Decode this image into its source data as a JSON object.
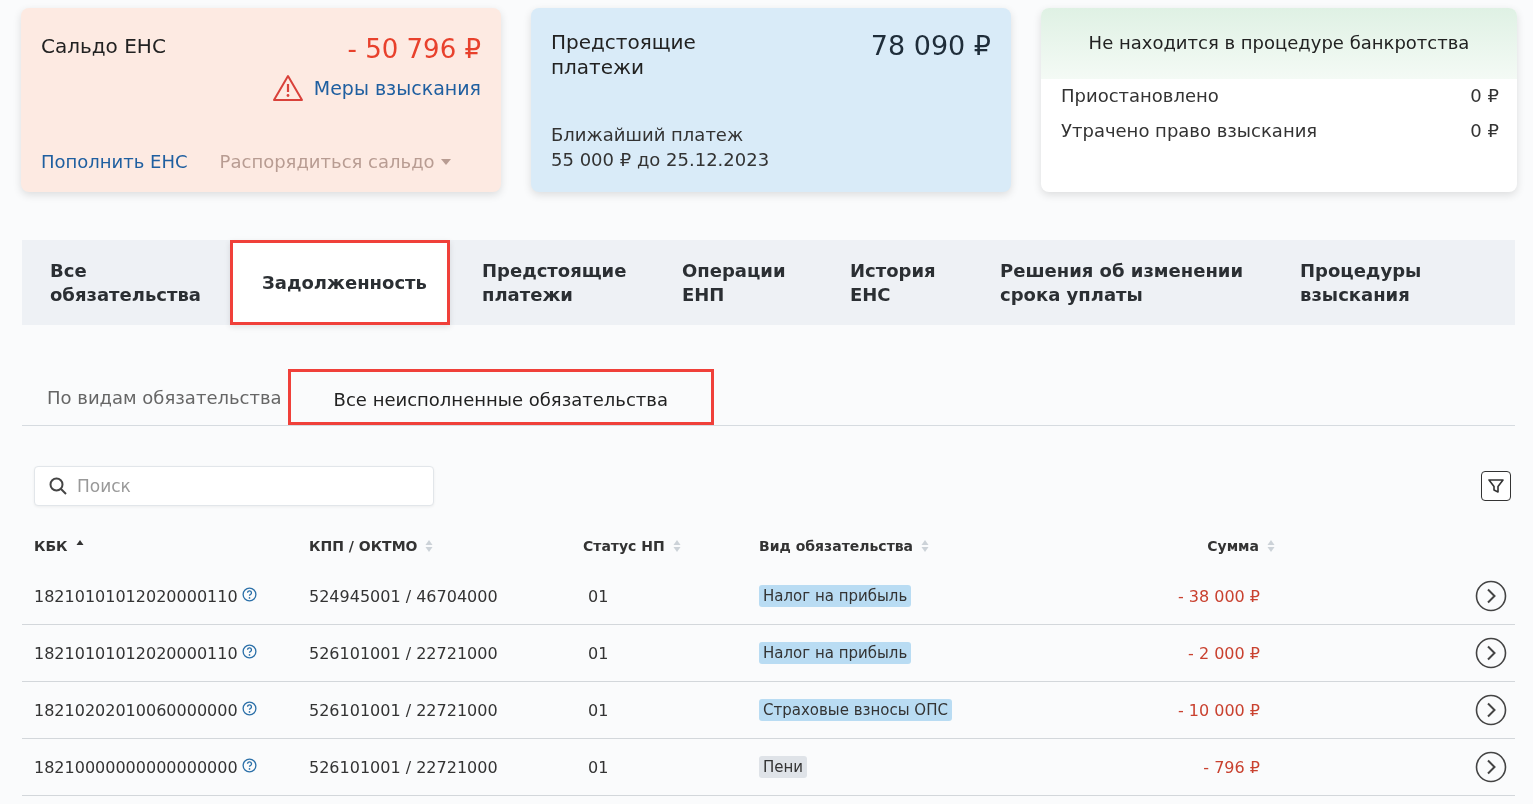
{
  "cards": {
    "balance": {
      "title": "Сальдо ЕНС",
      "amount": "- 50 796 ₽",
      "warning_link": "Меры взыскания",
      "actions": [
        {
          "label": "Пополнить ЕНС",
          "disabled": false,
          "dropdown": false
        },
        {
          "label": "Распорядиться сальдо",
          "disabled": true,
          "dropdown": true
        }
      ]
    },
    "upcoming": {
      "title": "Предстоящие платежи",
      "amount": "78 090 ₽",
      "next_label": "Ближайший платеж",
      "next_value": "55 000 ₽ до 25.12.2023"
    },
    "bankruptcy": {
      "title": "Не находится в процедуре банкротства",
      "rows": [
        {
          "label": "Приостановлено",
          "value": "0 ₽"
        },
        {
          "label": "Утрачено право взыскания",
          "value": "0 ₽"
        }
      ]
    }
  },
  "tabs": [
    {
      "label": "Все обязательства",
      "selected": false,
      "highlighted": false
    },
    {
      "label": "Задолженность",
      "selected": true,
      "highlighted": true
    },
    {
      "label": "Предстоящие платежи",
      "selected": false,
      "highlighted": false
    },
    {
      "label": "Операции ЕНП",
      "selected": false,
      "highlighted": false
    },
    {
      "label": "История ЕНС",
      "selected": false,
      "highlighted": false
    },
    {
      "label": "Решения об изменении срока уплаты",
      "selected": false,
      "highlighted": false
    },
    {
      "label": "Процедуры взыскания",
      "selected": false,
      "highlighted": false
    }
  ],
  "subtabs": [
    {
      "label": "По видам обязательства",
      "selected": false,
      "highlighted": false
    },
    {
      "label": "Все неисполненные обязательства",
      "selected": true,
      "highlighted": true
    }
  ],
  "search": {
    "placeholder": "Поиск"
  },
  "table": {
    "columns": [
      {
        "label": "КБК",
        "sorted": true
      },
      {
        "label": "КПП / ОКТМО",
        "sorted": false
      },
      {
        "label": "Статус НП",
        "sorted": false
      },
      {
        "label": "Вид обязательства",
        "sorted": false
      },
      {
        "label": "Сумма",
        "sorted": false
      }
    ],
    "rows": [
      {
        "kbk": "18210101012020000110",
        "kpp_oktmo": "524945001 / 46704000",
        "status": "01",
        "type": {
          "label": "Налог на прибыль",
          "color": "#b9dcf3"
        },
        "sum": "- 38 000 ₽"
      },
      {
        "kbk": "18210101012020000110",
        "kpp_oktmo": "526101001 / 22721000",
        "status": "01",
        "type": {
          "label": "Налог на прибыль",
          "color": "#b9dcf3"
        },
        "sum": "- 2 000 ₽"
      },
      {
        "kbk": "18210202010060000000",
        "kpp_oktmo": "526101001 / 22721000",
        "status": "01",
        "type": {
          "label": "Страховые взносы ОПС",
          "color": "#b9dcf3"
        },
        "sum": "- 10 000 ₽"
      },
      {
        "kbk": "18210000000000000000",
        "kpp_oktmo": "526101001 / 22721000",
        "status": "01",
        "type": {
          "label": "Пени",
          "color": "#dfe3e8"
        },
        "sum": "- 796 ₽"
      }
    ]
  }
}
